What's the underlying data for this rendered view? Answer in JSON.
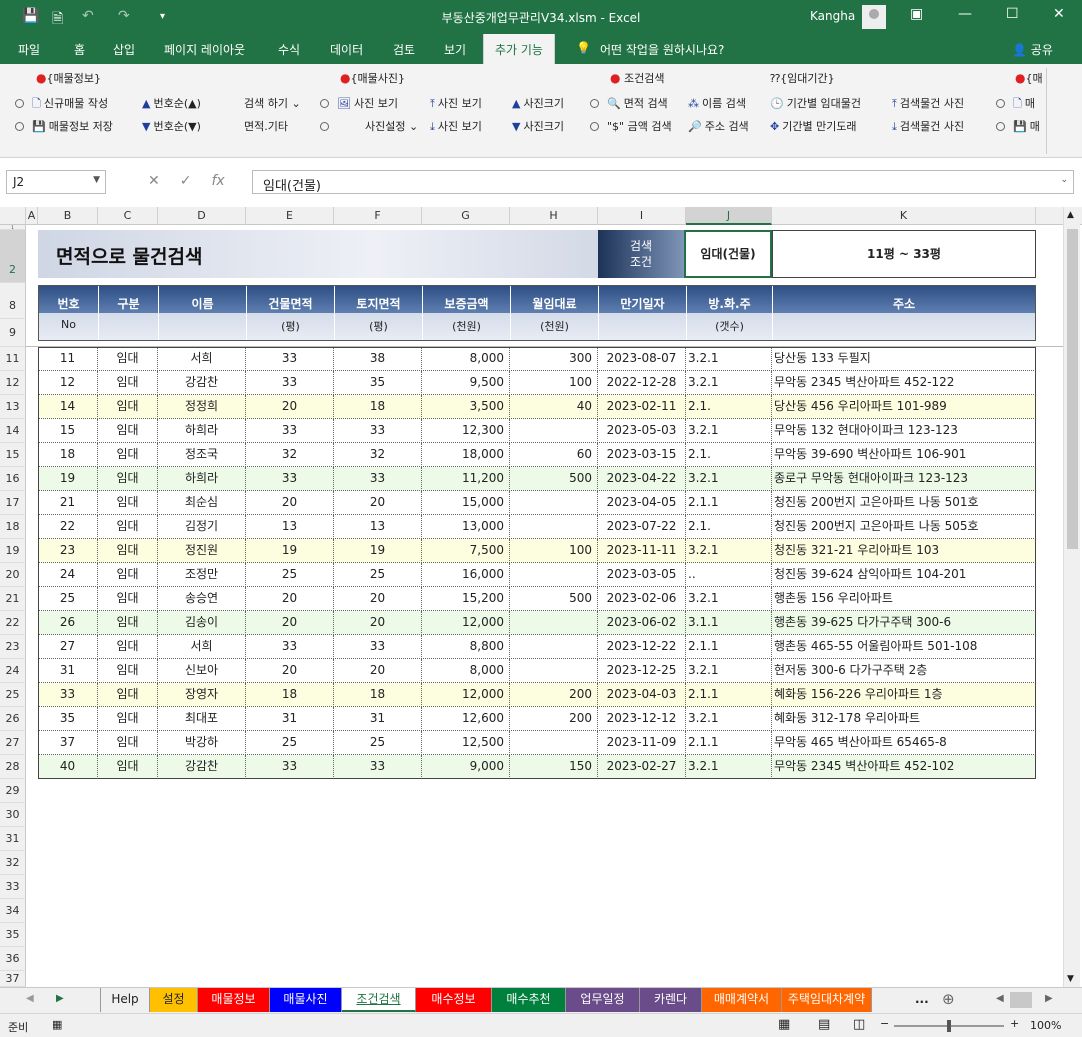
{
  "window": {
    "title": "부동산중개업무관리V34.xlsm  -  Excel",
    "user": "Kangha",
    "colors": {
      "accent": "#217346",
      "header_dark": "#2e4f84",
      "row_yellow": "#fdfde0",
      "row_green": "#eefae8"
    }
  },
  "ribbon_tabs": [
    "파일",
    "홈",
    "삽입",
    "페이지 레이아웃",
    "수식",
    "데이터",
    "검토",
    "보기",
    "추가 기능"
  ],
  "tell_me": "어떤 작업을 원하시나요?",
  "share": "공유",
  "ribbon": {
    "groups": [
      "{매물정보}",
      "{매물사진}",
      "조건검색",
      "{임대기간}",
      "{매"
    ],
    "items": {
      "new": "신규매물 작성",
      "save": "매물정보 저장",
      "sort_up": "번호순(▲)",
      "sort_down": "번호순(▼)",
      "search_do": "검색 하기",
      "area_etc": "면적.기타",
      "photo_view": "사진 보기",
      "photo_set": "사진설정",
      "photo_view2": "사진 보기",
      "photo_view3": "사진 보기",
      "photo_size": "사진크기",
      "photo_size2": "사진크기",
      "area_search": "면적 검색",
      "amount_search": "\"$\" 금액 검색",
      "name_search": "이름 검색",
      "addr_search": "주소 검색",
      "period_lease": "기간별 임대물건",
      "period_expire": "기간별 만기도래",
      "result_photo": "검색물건 사진",
      "result_photo2": "검색물건 사진",
      "trunc1": "매",
      "trunc2": "매"
    }
  },
  "formula_bar": {
    "cell_ref": "J2",
    "content": "임대(건물)"
  },
  "columns": [
    "A",
    "B",
    "C",
    "D",
    "E",
    "F",
    "G",
    "H",
    "I",
    "J",
    "K"
  ],
  "rows_visible": [
    "1",
    "2",
    "8",
    "9",
    "11",
    "12",
    "13",
    "14",
    "15",
    "16",
    "17",
    "18",
    "19",
    "20",
    "21",
    "22",
    "23",
    "24",
    "25",
    "26",
    "27",
    "28",
    "29",
    "30",
    "31",
    "32",
    "33",
    "34",
    "35",
    "36",
    "37"
  ],
  "sheet": {
    "title": "면적으로 물건검색",
    "search_label_1": "검색",
    "search_label_2": "조건",
    "condition_type": "임대(건물)",
    "condition_range": "11평 ~ 33평"
  },
  "table": {
    "headers": [
      {
        "top": "번호",
        "bottom": "No"
      },
      {
        "top": "구분",
        "bottom": ""
      },
      {
        "top": "이름",
        "bottom": ""
      },
      {
        "top": "건물면적",
        "bottom": "(평)"
      },
      {
        "top": "토지면적",
        "bottom": "(평)"
      },
      {
        "top": "보증금액",
        "bottom": "(천원)"
      },
      {
        "top": "월임대료",
        "bottom": "(천원)"
      },
      {
        "top": "만기일자",
        "bottom": ""
      },
      {
        "top": "방.화.주",
        "bottom": "(갯수)"
      },
      {
        "top": "주소",
        "bottom": ""
      }
    ],
    "rows": [
      [
        "11",
        "임대",
        "서희",
        "33",
        "38",
        "8,000",
        "300",
        "2023-08-07",
        "3.2.1",
        "당산동 133 두필지"
      ],
      [
        "12",
        "임대",
        "강감찬",
        "33",
        "35",
        "9,500",
        "100",
        "2022-12-28",
        "3.2.1",
        "무악동 2345 벽산아파트 452-122"
      ],
      [
        "14",
        "임대",
        "정정희",
        "20",
        "18",
        "3,500",
        "40",
        "2023-02-11",
        "2.1.",
        "당산동 456 우리아파트 101-989"
      ],
      [
        "15",
        "임대",
        "하희라",
        "33",
        "33",
        "12,300",
        "",
        "2023-05-03",
        "3.2.1",
        "무악동 132 현대아이파크 123-123"
      ],
      [
        "18",
        "임대",
        "정조국",
        "32",
        "32",
        "18,000",
        "60",
        "2023-03-15",
        "2.1.",
        "무악동 39-690 벽산아파트 106-901"
      ],
      [
        "19",
        "임대",
        "하희라",
        "33",
        "33",
        "11,200",
        "500",
        "2023-04-22",
        "3.2.1",
        "종로구 무악동 현대아이파크 123-123"
      ],
      [
        "21",
        "임대",
        "최순심",
        "20",
        "20",
        "15,000",
        "",
        "2023-04-05",
        "2.1.1",
        "청진동 200번지 고은아파트 나동 501호"
      ],
      [
        "22",
        "임대",
        "김정기",
        "13",
        "13",
        "13,000",
        "",
        "2023-07-22",
        "2.1.",
        "청진동 200번지 고은아파트 나동 505호"
      ],
      [
        "23",
        "임대",
        "정진원",
        "19",
        "19",
        "7,500",
        "100",
        "2023-11-11",
        "3.2.1",
        "청진동 321-21 우리아파트 103"
      ],
      [
        "24",
        "임대",
        "조정만",
        "25",
        "25",
        "16,000",
        "",
        "2023-03-05",
        "..",
        "청진동 39-624 삼익아파트 104-201"
      ],
      [
        "25",
        "임대",
        "송승연",
        "20",
        "20",
        "15,200",
        "500",
        "2023-02-06",
        "3.2.1",
        "행촌동 156 우리아파트"
      ],
      [
        "26",
        "임대",
        "김송이",
        "20",
        "20",
        "12,000",
        "",
        "2023-06-02",
        "3.1.1",
        "행촌동 39-625 다가구주택 300-6"
      ],
      [
        "27",
        "임대",
        "서희",
        "33",
        "33",
        "8,800",
        "",
        "2023-12-22",
        "2.1.1",
        "행촌동 465-55 어울림아파트 501-108"
      ],
      [
        "31",
        "임대",
        "신보아",
        "20",
        "20",
        "8,000",
        "",
        "2023-12-25",
        "3.2.1",
        "현저동 300-6 다가구주택 2층"
      ],
      [
        "33",
        "임대",
        "장영자",
        "18",
        "18",
        "12,000",
        "200",
        "2023-04-03",
        "2.1.1",
        "혜화동 156-226 우리아파트 1층"
      ],
      [
        "35",
        "임대",
        "최대포",
        "31",
        "31",
        "12,600",
        "200",
        "2023-12-12",
        "3.2.1",
        "혜화동 312-178 우리아파트"
      ],
      [
        "37",
        "임대",
        "박강하",
        "25",
        "25",
        "12,500",
        "",
        "2023-11-09",
        "2.1.1",
        "무악동 465 벽산아파트 65465-8"
      ],
      [
        "40",
        "임대",
        "강감찬",
        "33",
        "33",
        "9,000",
        "150",
        "2023-02-27",
        "3.2.1",
        "무악동 2345 벽산아파트 452-102"
      ]
    ]
  },
  "sheet_tabs": [
    {
      "name": "Help",
      "color": "#f0f0f0",
      "fg": "#222"
    },
    {
      "name": "설정",
      "color": "#ffc000",
      "fg": "#222"
    },
    {
      "name": "매물정보",
      "color": "#ff0000",
      "fg": "#fff"
    },
    {
      "name": "매물사진",
      "color": "#0000ff",
      "fg": "#fff"
    },
    {
      "name": "조건검색",
      "color": "#ffffff",
      "fg": "#217346"
    },
    {
      "name": "매수정보",
      "color": "#ff0000",
      "fg": "#fff"
    },
    {
      "name": "매수추천",
      "color": "#00803c",
      "fg": "#fff"
    },
    {
      "name": "업무일정",
      "color": "#6b4c8a",
      "fg": "#fff"
    },
    {
      "name": "카렌다",
      "color": "#6b4c8a",
      "fg": "#fff"
    },
    {
      "name": "매매계약서",
      "color": "#ff6600",
      "fg": "#fff"
    },
    {
      "name": "주택임대차계약",
      "color": "#ff6600",
      "fg": "#fff"
    }
  ],
  "more_tabs": "...",
  "status": {
    "ready": "준비",
    "zoom": "100%",
    "zoom_level_percent": 100
  }
}
